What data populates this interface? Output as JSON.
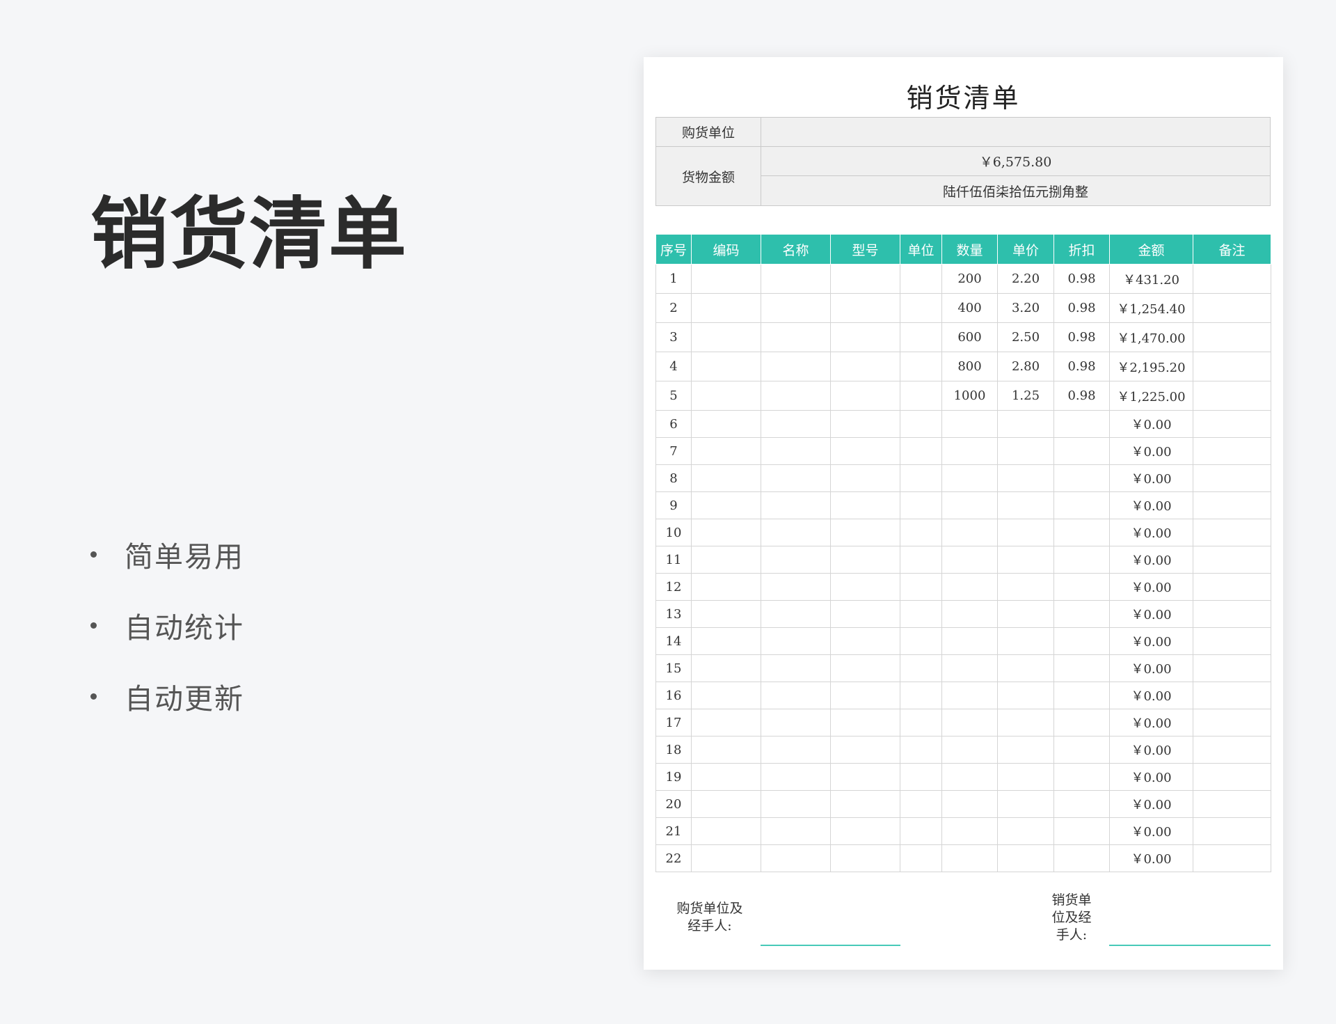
{
  "promo": {
    "title": "销货清单",
    "features": [
      "简单易用",
      "自动统计",
      "自动更新"
    ]
  },
  "sheet": {
    "title": "销货清单",
    "buyer_label": "购货单位",
    "buyer_value": "",
    "amount_label": "货物金额",
    "amount_value": "￥6,575.80",
    "amount_in_words": "陆仟伍佰柒拾伍元捌角整",
    "columns": [
      "序号",
      "编码",
      "名称",
      "型号",
      "单位",
      "数量",
      "单价",
      "折扣",
      "金额",
      "备注"
    ],
    "rows": [
      [
        "1",
        "",
        "",
        "",
        "",
        "200",
        "2.20",
        "0.98",
        "￥431.20",
        ""
      ],
      [
        "2",
        "",
        "",
        "",
        "",
        "400",
        "3.20",
        "0.98",
        "￥1,254.40",
        ""
      ],
      [
        "3",
        "",
        "",
        "",
        "",
        "600",
        "2.50",
        "0.98",
        "￥1,470.00",
        ""
      ],
      [
        "4",
        "",
        "",
        "",
        "",
        "800",
        "2.80",
        "0.98",
        "￥2,195.20",
        ""
      ],
      [
        "5",
        "",
        "",
        "",
        "",
        "1000",
        "1.25",
        "0.98",
        "￥1,225.00",
        ""
      ],
      [
        "6",
        "",
        "",
        "",
        "",
        "",
        "",
        "",
        "￥0.00",
        ""
      ],
      [
        "7",
        "",
        "",
        "",
        "",
        "",
        "",
        "",
        "￥0.00",
        ""
      ],
      [
        "8",
        "",
        "",
        "",
        "",
        "",
        "",
        "",
        "￥0.00",
        ""
      ],
      [
        "9",
        "",
        "",
        "",
        "",
        "",
        "",
        "",
        "￥0.00",
        ""
      ],
      [
        "10",
        "",
        "",
        "",
        "",
        "",
        "",
        "",
        "￥0.00",
        ""
      ],
      [
        "11",
        "",
        "",
        "",
        "",
        "",
        "",
        "",
        "￥0.00",
        ""
      ],
      [
        "12",
        "",
        "",
        "",
        "",
        "",
        "",
        "",
        "￥0.00",
        ""
      ],
      [
        "13",
        "",
        "",
        "",
        "",
        "",
        "",
        "",
        "￥0.00",
        ""
      ],
      [
        "14",
        "",
        "",
        "",
        "",
        "",
        "",
        "",
        "￥0.00",
        ""
      ],
      [
        "15",
        "",
        "",
        "",
        "",
        "",
        "",
        "",
        "￥0.00",
        ""
      ],
      [
        "16",
        "",
        "",
        "",
        "",
        "",
        "",
        "",
        "￥0.00",
        ""
      ],
      [
        "17",
        "",
        "",
        "",
        "",
        "",
        "",
        "",
        "￥0.00",
        ""
      ],
      [
        "18",
        "",
        "",
        "",
        "",
        "",
        "",
        "",
        "￥0.00",
        ""
      ],
      [
        "19",
        "",
        "",
        "",
        "",
        "",
        "",
        "",
        "￥0.00",
        ""
      ],
      [
        "20",
        "",
        "",
        "",
        "",
        "",
        "",
        "",
        "￥0.00",
        ""
      ],
      [
        "21",
        "",
        "",
        "",
        "",
        "",
        "",
        "",
        "￥0.00",
        ""
      ],
      [
        "22",
        "",
        "",
        "",
        "",
        "",
        "",
        "",
        "￥0.00",
        ""
      ]
    ],
    "signature": {
      "buyer_label_line1": "购货单位及",
      "buyer_label_line2": "经手人:",
      "seller_label_line1": "销货单",
      "seller_label_line2": "位及经",
      "seller_label_line3": "手人:"
    }
  },
  "colors": {
    "header_teal": "#2ebfac",
    "signature_line": "#48c9b8",
    "info_gray": "#f0f0f0"
  }
}
